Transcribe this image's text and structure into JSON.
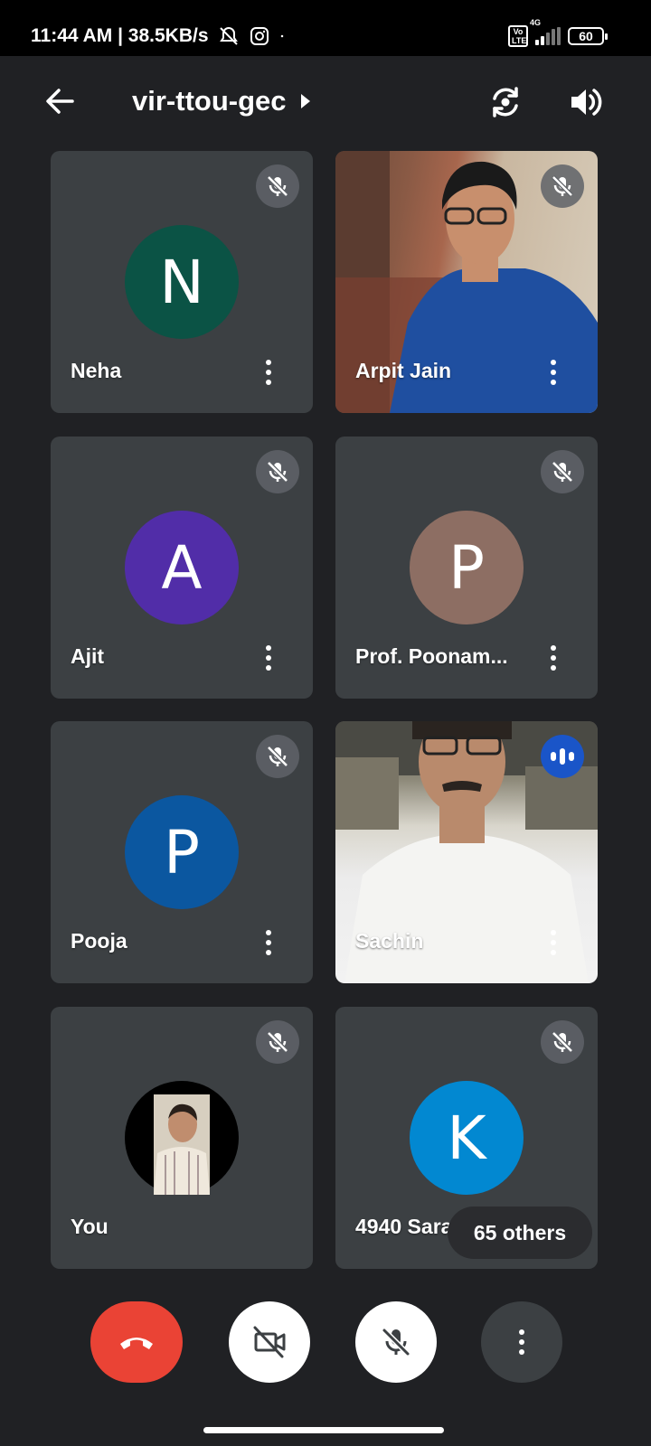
{
  "status_bar": {
    "time_speed": "11:44 AM | 38.5KB/s",
    "network_type": "4G",
    "battery": "60",
    "volte": "Vo LTE",
    "icons": [
      "mute-notifications-icon",
      "instagram-icon",
      "dot-icon",
      "signal-icon",
      "battery-icon"
    ]
  },
  "header": {
    "title": "vir-ttou-gec",
    "icons": [
      "back-arrow-icon",
      "chevron-right-icon",
      "switch-camera-icon",
      "speaker-icon"
    ]
  },
  "participants": [
    {
      "name": "Neha",
      "initial": "N",
      "avatar_color": "#0b5345",
      "muted": true,
      "video": false
    },
    {
      "name": "Arpit Jain",
      "initial": "",
      "muted": true,
      "video": true
    },
    {
      "name": "Ajit",
      "initial": "A",
      "avatar_color": "#512da8",
      "muted": true,
      "video": false
    },
    {
      "name": "Prof. Poonam...",
      "initial": "P",
      "avatar_color": "#8d6e63",
      "muted": true,
      "video": false
    },
    {
      "name": "Pooja",
      "initial": "P",
      "avatar_color": "#0b57a0",
      "muted": true,
      "video": false
    },
    {
      "name": "Sachin",
      "initial": "",
      "muted": false,
      "speaking": true,
      "video": true
    },
    {
      "name": "You",
      "initial": "",
      "muted": true,
      "video": false,
      "photo": true
    },
    {
      "name": "4940 Sara",
      "initial": "K",
      "avatar_color": "#0288d1",
      "muted": true,
      "video": false
    }
  ],
  "others_label": "65 others",
  "controls": {
    "end_call": "end-call-icon",
    "camera": "camera-off-icon",
    "microphone": "mic-off-icon",
    "more": "more-vert-icon"
  },
  "colors": {
    "background": "#202124",
    "tile": "#3c4043",
    "end_call": "#ea4335",
    "speaking": "#1a55c8"
  }
}
